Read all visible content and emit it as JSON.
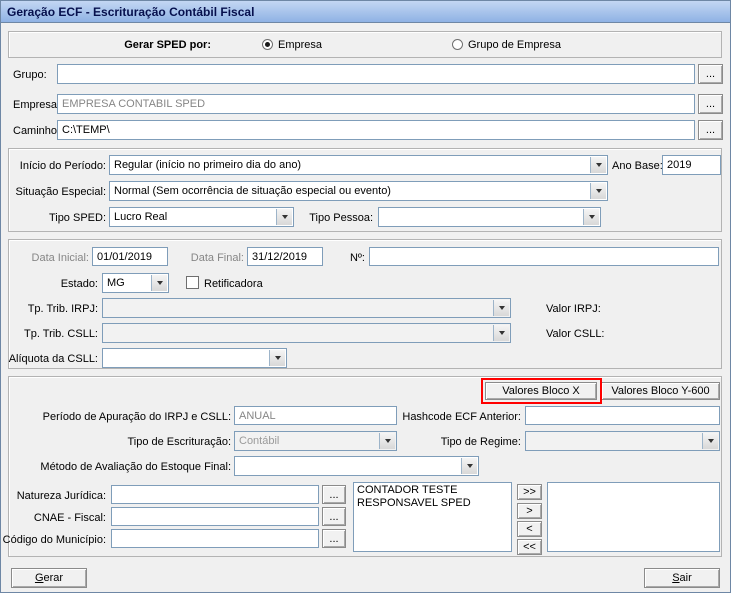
{
  "window": {
    "title": "Geração ECF - Escrituração Contábil Fiscal"
  },
  "top": {
    "gerar_sped_por_label": "Gerar SPED por:",
    "radio_empresa": "Empresa",
    "radio_grupo_empresa": "Grupo de Empresa"
  },
  "fields": {
    "grupo_label": "Grupo:",
    "grupo_value": "",
    "empresa_label": "Empresa:",
    "empresa_value": "EMPRESA CONTABIL SPED",
    "caminho_label": "Caminho:",
    "caminho_value": "C:\\TEMP\\",
    "browse_label": "..."
  },
  "periodo": {
    "inicio_label": "Início do Período:",
    "inicio_value": "Regular (início no primeiro dia do ano)",
    "ano_base_label": "Ano Base:",
    "ano_base_value": "2019",
    "situacao_label": "Situação Especial:",
    "situacao_value": "Normal (Sem ocorrência de situação especial ou evento)",
    "tipo_sped_label": "Tipo SPED:",
    "tipo_sped_value": "Lucro Real",
    "tipo_pessoa_label": "Tipo Pessoa:",
    "tipo_pessoa_value": ""
  },
  "dados": {
    "data_inicial_label": "Data Inicial:",
    "data_inicial_value": "01/01/2019",
    "data_final_label": "Data Final:",
    "data_final_value": "31/12/2019",
    "numero_label": "Nº:",
    "numero_value": "",
    "estado_label": "Estado:",
    "estado_value": "MG",
    "retificadora_label": "Retificadora",
    "tp_trib_irpj_label": "Tp. Trib. IRPJ:",
    "tp_trib_irpj_value": "",
    "valor_irpj_label": "Valor IRPJ:",
    "tp_trib_csll_label": "Tp. Trib. CSLL:",
    "tp_trib_csll_value": "",
    "valor_csll_label": "Valor CSLL:",
    "aliquota_csll_label": "Alíquota da CSLL:",
    "aliquota_csll_value": ""
  },
  "bloco": {
    "valores_bloco_x": "Valores Bloco X",
    "valores_bloco_y": "Valores Bloco Y-600",
    "periodo_apuracao_label": "Período de Apuração do IRPJ e CSLL:",
    "periodo_apuracao_value": "ANUAL",
    "hashcode_label": "Hashcode ECF Anterior:",
    "hashcode_value": "",
    "tipo_escrituracao_label": "Tipo de Escrituração:",
    "tipo_escrituracao_value": "Contábil",
    "tipo_regime_label": "Tipo de Regime:",
    "tipo_regime_value": "",
    "metodo_label": "Método de Avaliação do Estoque Final:",
    "metodo_value": "",
    "natureza_label": "Natureza Jurídica:",
    "natureza_value": "",
    "cnae_label": "CNAE - Fiscal:",
    "cnae_value": "",
    "municipio_label": "Código do Município:",
    "municipio_value": ""
  },
  "transfer": {
    "source_items": [
      "CONTADOR TESTE",
      "RESPONSAVEL SPED"
    ],
    "buttons": [
      ">>",
      ">",
      "<",
      "<<"
    ],
    "target_items": []
  },
  "footer": {
    "gerar_accel": "G",
    "gerar_rest": "erar",
    "sair_accel": "S",
    "sair_rest": "air"
  },
  "annotation": {
    "highlight_color": "#ff0000"
  }
}
